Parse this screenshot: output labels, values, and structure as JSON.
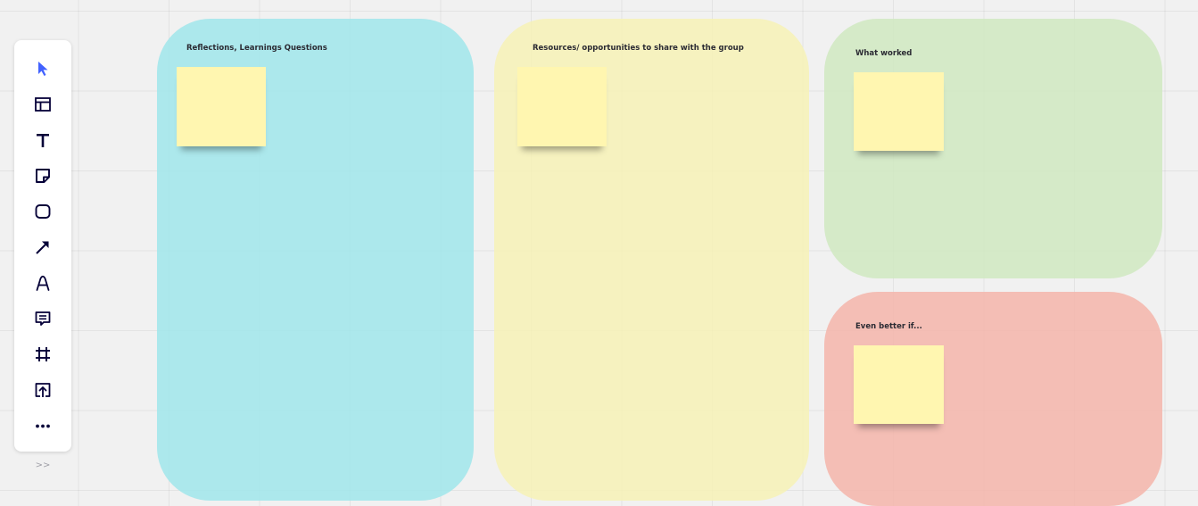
{
  "toolbar": {
    "tools": [
      {
        "name": "select-tool",
        "icon": "cursor-arrow-icon"
      },
      {
        "name": "templates-tool",
        "icon": "layout-template-icon"
      },
      {
        "name": "text-tool",
        "icon": "text-t-icon"
      },
      {
        "name": "sticky-note-tool",
        "icon": "sticky-note-icon"
      },
      {
        "name": "shape-tool",
        "icon": "rounded-rectangle-icon"
      },
      {
        "name": "connection-line-tool",
        "icon": "arrow-diagonal-icon"
      },
      {
        "name": "pen-tool",
        "icon": "pen-a-icon"
      },
      {
        "name": "comment-tool",
        "icon": "comment-icon"
      },
      {
        "name": "frame-tool",
        "icon": "frame-hash-icon"
      },
      {
        "name": "upload-tool",
        "icon": "upload-icon"
      },
      {
        "name": "more-tools",
        "icon": "more-dots-icon"
      }
    ],
    "collapse_label": ">>",
    "accent_color": "#4262ff"
  },
  "board": {
    "frames": [
      {
        "title": "Reflections, Learnings Questions",
        "color": "#a2e6ea"
      },
      {
        "title": "Resources/ opportunities to share with the group",
        "color": "#f6f1b7"
      },
      {
        "title": "What worked",
        "color": "#d0e8c2"
      },
      {
        "title": "Even better if...",
        "color": "#f4b6ac"
      }
    ],
    "sticky_note_color": "#fff6b0"
  }
}
